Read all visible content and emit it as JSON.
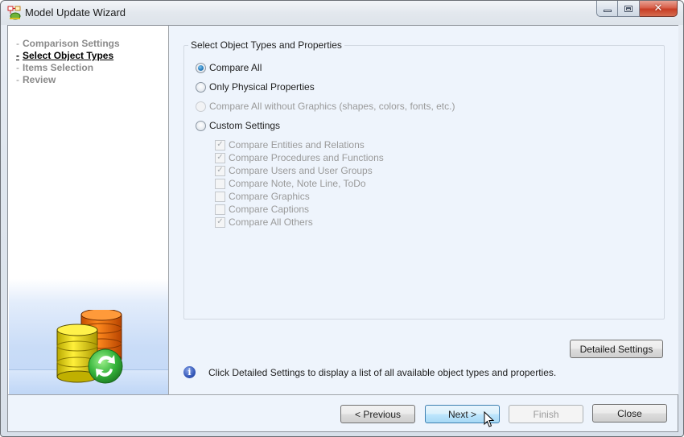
{
  "window": {
    "title": "Model Update Wizard",
    "app_icon": "model-update-wizard-icon",
    "caption_buttons": {
      "minimize_icon": "minimize-icon",
      "maximize_icon": "maximize-icon",
      "close_icon": "close-icon",
      "close_glyph": "✕"
    }
  },
  "sidebar": {
    "steps": [
      {
        "dash": "-",
        "label": "Comparison Settings",
        "active": false
      },
      {
        "dash": "-",
        "label": "Select Object Types",
        "active": true
      },
      {
        "dash": "-",
        "label": "Items Selection",
        "active": false
      },
      {
        "dash": "-",
        "label": "Review",
        "active": false
      }
    ],
    "illustration": "database-sync-icon"
  },
  "main": {
    "group_title": "Select Object Types and Properties",
    "radio_options": [
      {
        "label": "Compare All",
        "checked": true,
        "enabled": true
      },
      {
        "label": "Only Physical Properties",
        "checked": false,
        "enabled": true
      },
      {
        "label": "Compare All without Graphics (shapes, colors, fonts, etc.)",
        "checked": false,
        "enabled": false
      },
      {
        "label": "Custom Settings",
        "checked": false,
        "enabled": true
      }
    ],
    "custom_checkboxes": [
      {
        "label": "Compare Entities and Relations",
        "checked": true,
        "enabled": false
      },
      {
        "label": "Compare Procedures and Functions",
        "checked": true,
        "enabled": false
      },
      {
        "label": "Compare Users and User Groups",
        "checked": true,
        "enabled": false
      },
      {
        "label": "Compare Note, Note Line, ToDo",
        "checked": false,
        "enabled": false
      },
      {
        "label": "Compare Graphics",
        "checked": false,
        "enabled": false
      },
      {
        "label": "Compare Captions",
        "checked": false,
        "enabled": false
      },
      {
        "label": "Compare All Others",
        "checked": true,
        "enabled": false
      }
    ],
    "check_glyph": "✓",
    "detailed_settings_label": "Detailed Settings",
    "info_glyph": "i",
    "info_text": "Click Detailed Settings to display a list of all available object types and properties."
  },
  "footer": {
    "previous_label": "< Previous",
    "next_label": "Next >",
    "finish_label": "Finish",
    "close_label": "Close"
  }
}
